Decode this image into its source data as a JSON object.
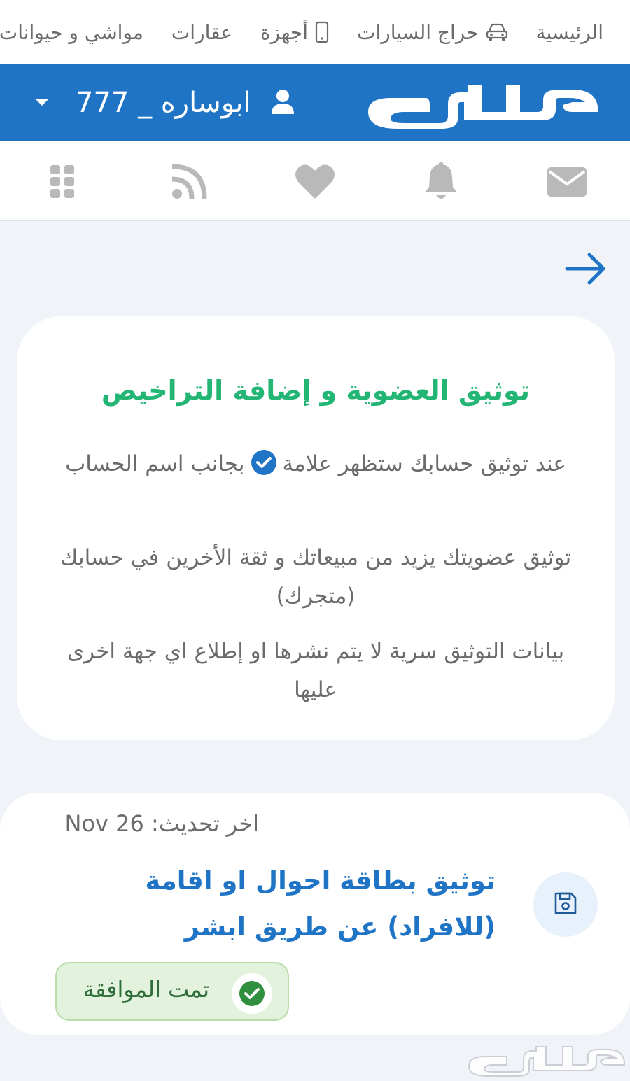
{
  "top_nav": {
    "items": [
      {
        "label": "الرئيسية",
        "icon": ""
      },
      {
        "label": "حراج السيارات",
        "icon": "car-icon"
      },
      {
        "label": "أجهزة",
        "icon": "phone-icon"
      },
      {
        "label": "عقارات",
        "icon": ""
      },
      {
        "label": "مواشي و حيوانات",
        "icon": ""
      }
    ]
  },
  "header": {
    "logo_text": "حراج",
    "username": "ابوساره _ 777",
    "bg_color": "#1f74c5"
  },
  "icon_bar": {
    "icons": [
      "mail-icon",
      "bell-icon",
      "heart-icon",
      "rss-icon",
      "grid-icon"
    ]
  },
  "verify_card": {
    "title": "توثيق العضوية و إضافة التراخيص",
    "para1_before": "عند توثيق حسابك ستظهر علامة",
    "para1_after": "بجانب اسم الحساب",
    "para2": "توثيق عضويتك يزيد من مبيعاتك و ثقة الأخرين في حسابك (متجرك)",
    "para3": "بيانات التوثيق سرية لا يتم نشرها او إطلاع اي جهة اخرى عليها",
    "title_color": "#22b573"
  },
  "status_card": {
    "last_update": "اخر تحديث: Nov 26",
    "title": "توثيق بطاقة احوال او اقامة (للافراد) عن طريق ابشر",
    "status_label": "تمت الموافقة",
    "status_color": "#2f6e3a"
  }
}
